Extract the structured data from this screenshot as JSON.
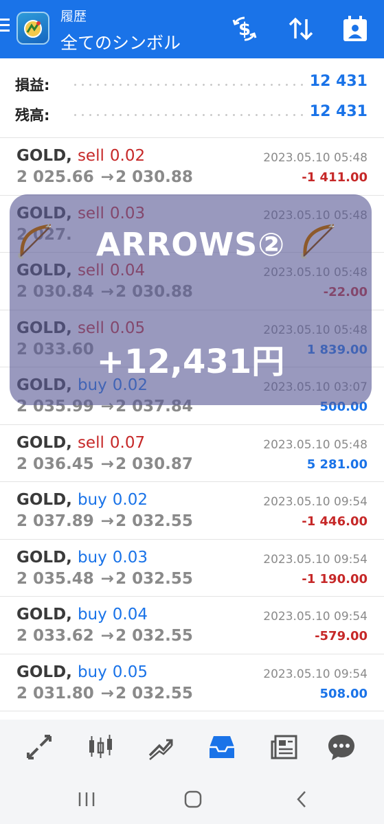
{
  "header": {
    "title": "履歴",
    "subtitle": "全てのシンボル",
    "colors": {
      "bar": "#1a73e8"
    },
    "icons": [
      "menu-icon",
      "app-logo-icon",
      "dollar-refresh-icon",
      "sort-icon",
      "calendar-person-icon"
    ]
  },
  "summary": {
    "profit_label": "損益:",
    "profit_value": "12 431",
    "balance_label": "残高:",
    "balance_value": "12 431"
  },
  "trades": [
    {
      "symbol": "GOLD,",
      "type": "sell",
      "volume": "0.02",
      "open": "2 025.66",
      "close": "2 030.88",
      "time": "2023.05.10 05:48",
      "profit": "-1 411.00",
      "direction": "neg"
    },
    {
      "symbol": "GOLD,",
      "type": "sell",
      "volume": "0.03",
      "open": "2 027.",
      "close": "",
      "time": "2023.05.10 05:48",
      "profit": "",
      "direction": "neg"
    },
    {
      "symbol": "GOLD,",
      "type": "sell",
      "volume": "0.04",
      "open": "2 030.84",
      "close": "2 030.88",
      "time": "2023.05.10 05:48",
      "profit": "-22.00",
      "direction": "neg"
    },
    {
      "symbol": "GOLD,",
      "type": "sell",
      "volume": "0.05",
      "open": "2 033.60",
      "close": "",
      "time": "2023.05.10 05:48",
      "profit": "1 839.00",
      "direction": "pos"
    },
    {
      "symbol": "GOLD,",
      "type": "buy",
      "volume": "0.02",
      "open": "2 035.99",
      "close": "2 037.84",
      "time": "2023.05.10 03:07",
      "profit": "500.00",
      "direction": "pos"
    },
    {
      "symbol": "GOLD,",
      "type": "sell",
      "volume": "0.07",
      "open": "2 036.45",
      "close": "2 030.87",
      "time": "2023.05.10 05:48",
      "profit": "5 281.00",
      "direction": "pos"
    },
    {
      "symbol": "GOLD,",
      "type": "buy",
      "volume": "0.02",
      "open": "2 037.89",
      "close": "2 032.55",
      "time": "2023.05.10 09:54",
      "profit": "-1 446.00",
      "direction": "neg"
    },
    {
      "symbol": "GOLD,",
      "type": "buy",
      "volume": "0.03",
      "open": "2 035.48",
      "close": "2 032.55",
      "time": "2023.05.10 09:54",
      "profit": "-1 190.00",
      "direction": "neg"
    },
    {
      "symbol": "GOLD,",
      "type": "buy",
      "volume": "0.04",
      "open": "2 033.62",
      "close": "2 032.55",
      "time": "2023.05.10 09:54",
      "profit": "-579.00",
      "direction": "neg"
    },
    {
      "symbol": "GOLD,",
      "type": "buy",
      "volume": "0.05",
      "open": "2 031.80",
      "close": "2 032.55",
      "time": "2023.05.10 09:54",
      "profit": "508.00",
      "direction": "pos"
    }
  ],
  "arrow_glyph": "→",
  "overlay": {
    "title": "ARROWS②",
    "amount": "+12,431円",
    "icon": "bow-and-arrow-icon"
  },
  "bottom_nav": {
    "items": [
      "quotes-icon",
      "chart-icon",
      "trade-icon",
      "history-icon",
      "news-icon",
      "chat-icon"
    ],
    "active": "history-icon",
    "active_color": "#1a73e8"
  },
  "system_nav": [
    "recent-apps-icon",
    "home-icon",
    "back-icon"
  ]
}
